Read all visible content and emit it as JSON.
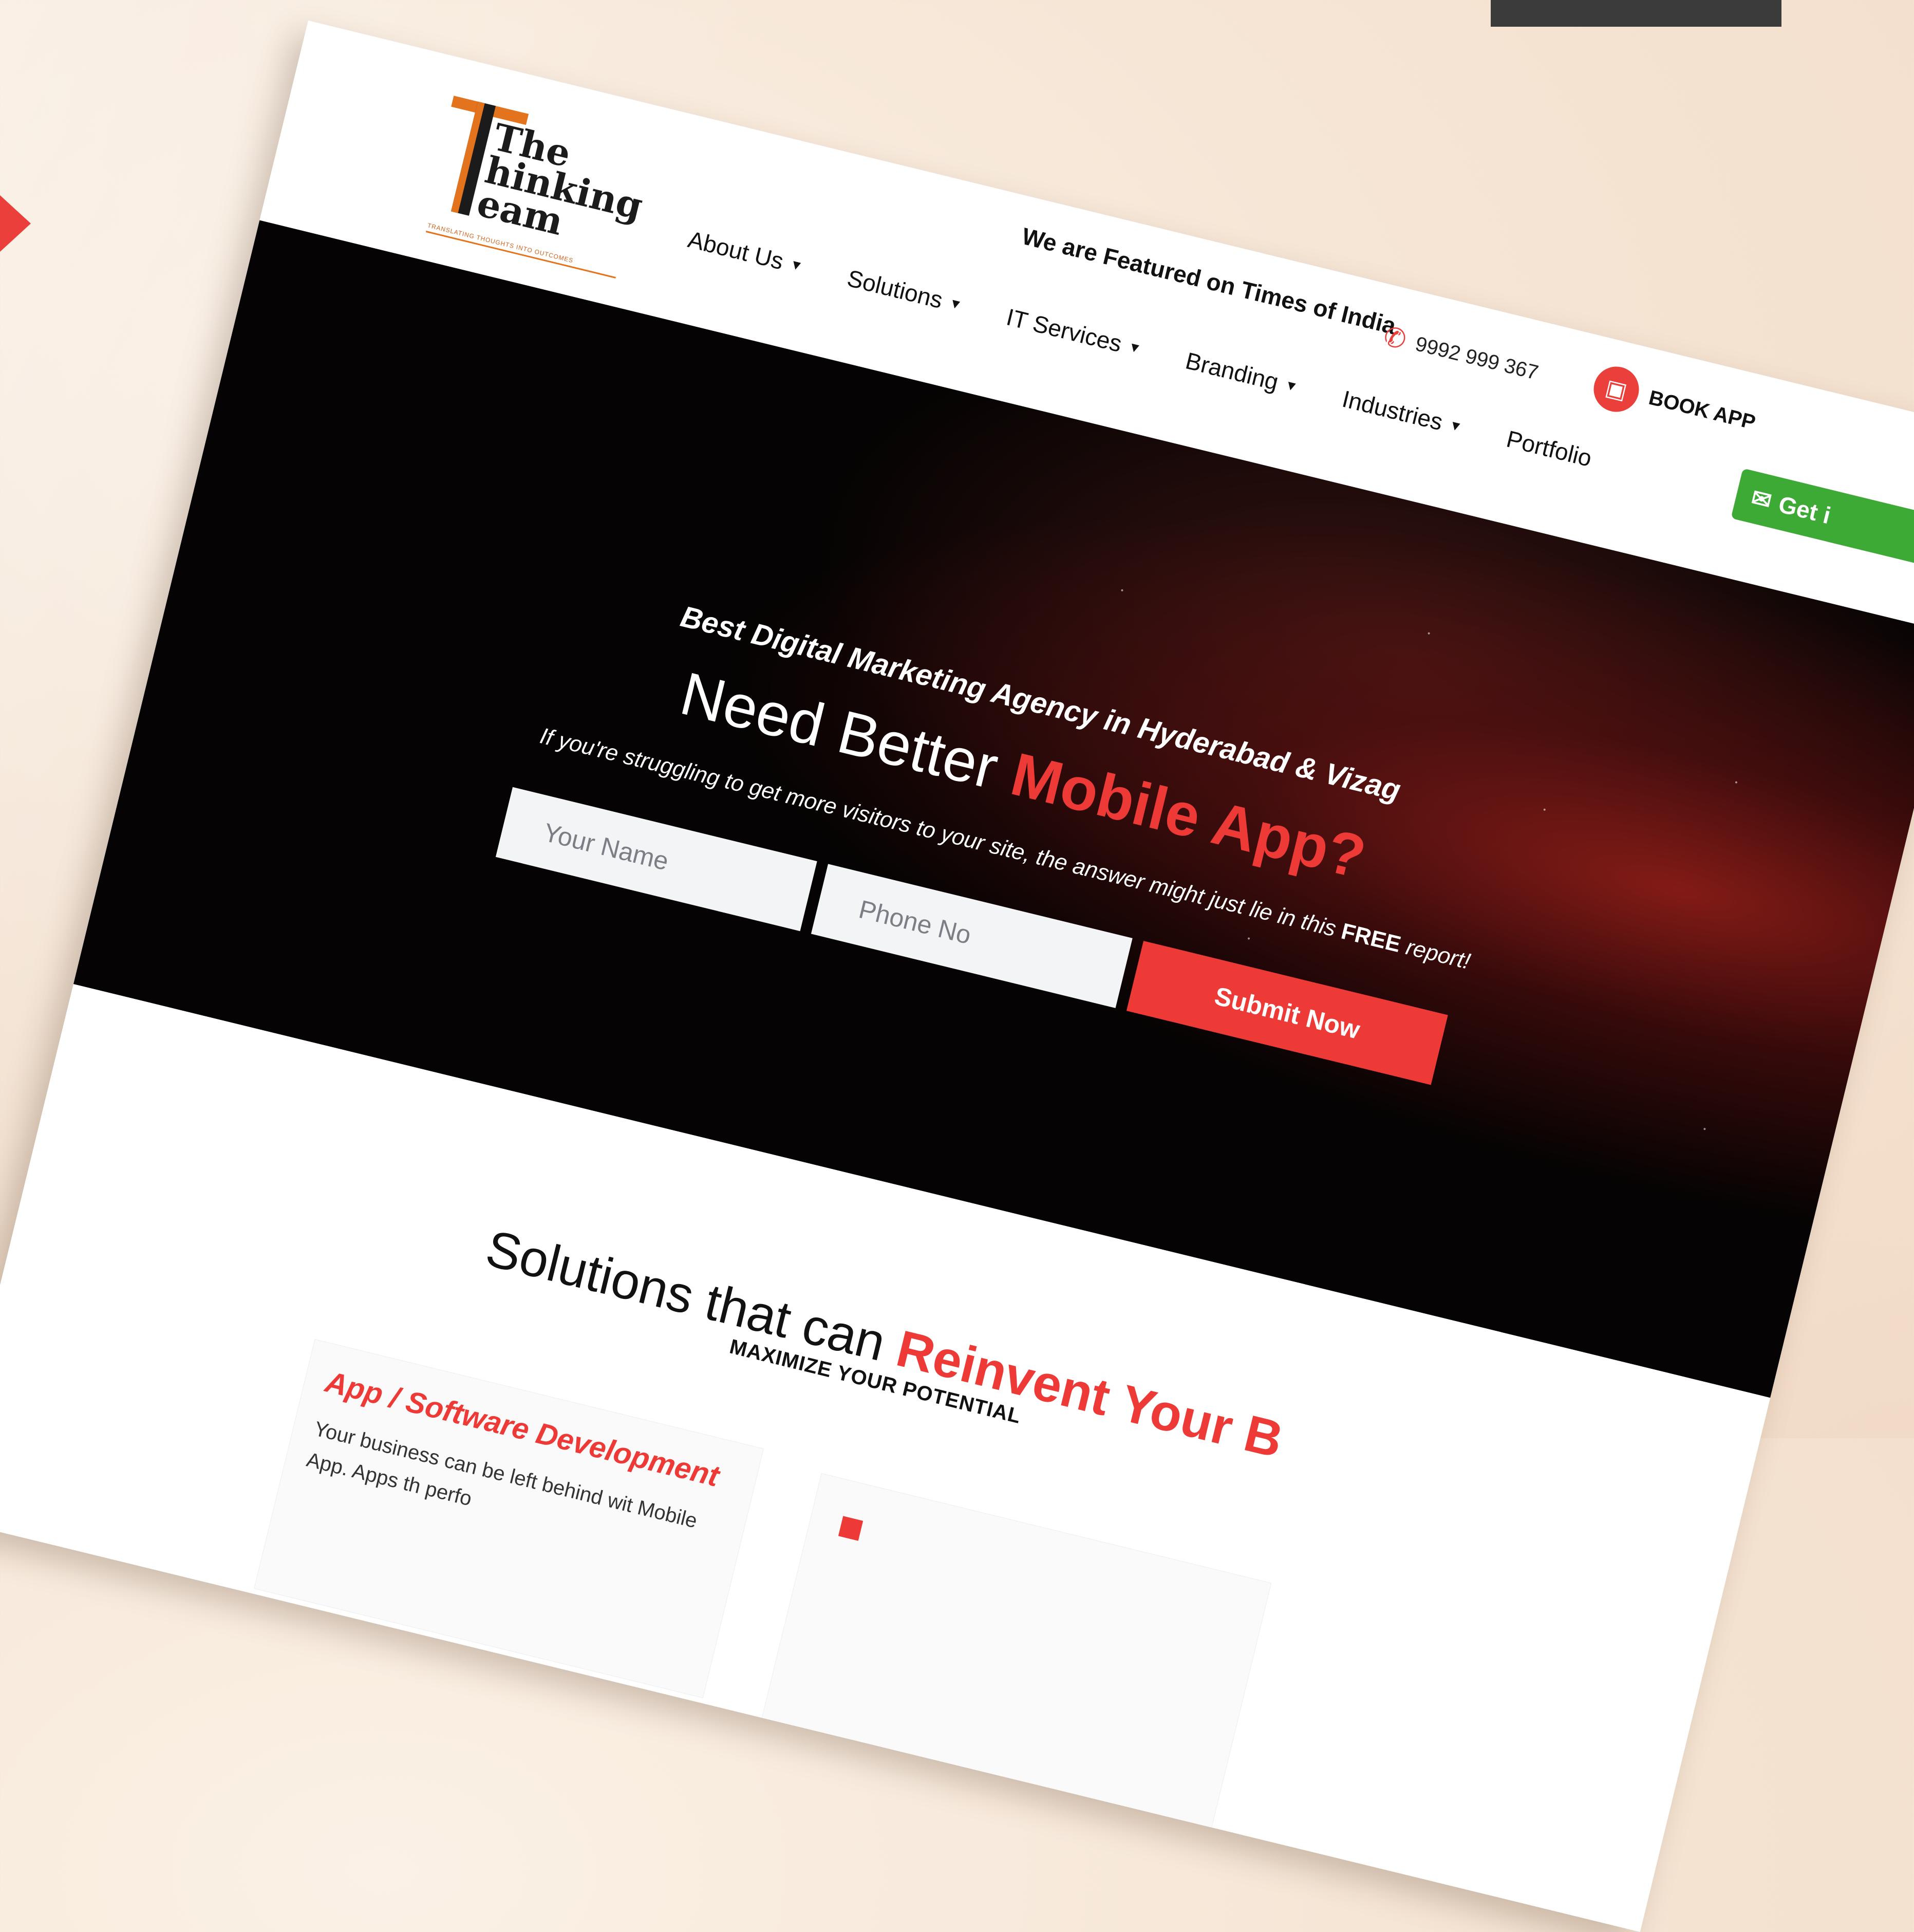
{
  "logo": {
    "line1": "The",
    "line2": "hinking",
    "line3": "eam",
    "tagline": "TRANSLATING THOUGHTS INTO OUTCOMES"
  },
  "featured_text": "We are Featured on Times of India",
  "phone": {
    "icon": "phone-icon",
    "number": "9992 999 367"
  },
  "book": {
    "icon": "calendar-icon",
    "label": "BOOK APP"
  },
  "nav": {
    "items": [
      {
        "label": "About Us",
        "dropdown": true
      },
      {
        "label": "Solutions",
        "dropdown": true
      },
      {
        "label": "IT Services",
        "dropdown": true
      },
      {
        "label": "Branding",
        "dropdown": true
      },
      {
        "label": "Industries",
        "dropdown": true
      },
      {
        "label": "Portfolio",
        "dropdown": false
      }
    ],
    "cta": "Get i"
  },
  "hero": {
    "tagline": "Best Digital Marketing Agency in Hyderabad & Vizag",
    "title_plain": "Need Better ",
    "title_accent": "Mobile App?",
    "subtitle_before": "If you're struggling to get more visitors to your site, the answer might just lie in this ",
    "subtitle_bold": "FREE",
    "subtitle_after": " report!",
    "form": {
      "name_placeholder": "Your Name",
      "phone_placeholder": "Phone No",
      "submit_label": "Submit Now"
    }
  },
  "solutions": {
    "eyebrow": "MAXIMIZE YOUR POTENTIAL",
    "title_plain": "Solutions that can ",
    "title_accent": "Reinvent Your B",
    "card1": {
      "title": "App / Software Development",
      "text": "Your business can be left behind wit Mobile App. Apps th perfo"
    }
  },
  "colors": {
    "accent": "#ee3a36",
    "cta_green": "#3eaa36",
    "logo_orange": "#e3731c"
  }
}
